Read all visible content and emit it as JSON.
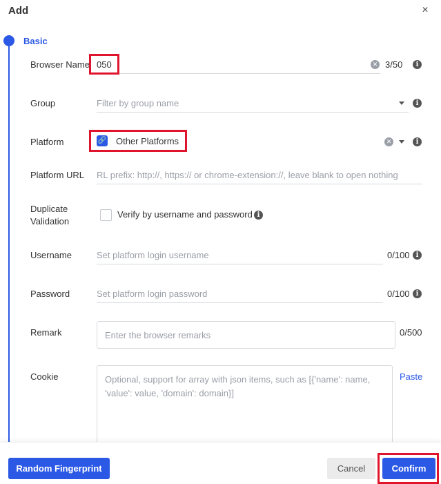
{
  "dialog": {
    "title": "Add",
    "close_glyph": "×"
  },
  "section": {
    "label": "Basic"
  },
  "fields": {
    "browser_name": {
      "label": "Browser Name",
      "value": "050",
      "counter": "3/50"
    },
    "group": {
      "label": "Group",
      "placeholder": "Filter by group name"
    },
    "platform": {
      "label": "Platform",
      "value": "Other Platforms",
      "icon": "link-icon"
    },
    "platform_url": {
      "label": "Platform URL",
      "placeholder": "RL prefix: http://, https:// or chrome-extension://, leave blank to open nothing"
    },
    "duplicate_validation": {
      "label_line1": "Duplicate",
      "label_line2": "Validation",
      "option": "Verify by username and password"
    },
    "username": {
      "label": "Username",
      "placeholder": "Set platform login username",
      "counter": "0/100"
    },
    "password": {
      "label": "Password",
      "placeholder": "Set platform login password",
      "counter": "0/100"
    },
    "remark": {
      "label": "Remark",
      "placeholder": "Enter the browser remarks",
      "counter": "0/500"
    },
    "cookie": {
      "label": "Cookie",
      "placeholder": "Optional, support for array with json items, such as [{'name': name, 'value': value, 'domain': domain}]",
      "paste": "Paste"
    }
  },
  "footer": {
    "random_fingerprint": "Random Fingerprint",
    "cancel": "Cancel",
    "confirm": "Confirm"
  },
  "colors": {
    "primary": "#2b59e6",
    "highlight": "#e0142c"
  }
}
